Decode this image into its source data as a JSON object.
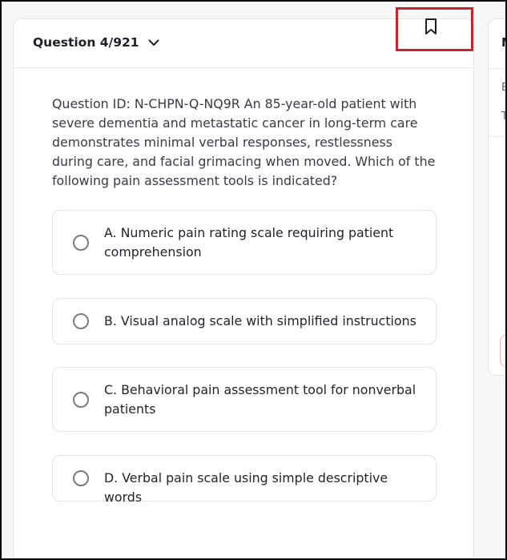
{
  "header": {
    "question_counter": "Question 4/921",
    "chevron_icon": "chevron-down-icon",
    "bookmark_icon": "bookmark-icon"
  },
  "question": {
    "text": "Question ID: N-CHPN-Q-NQ9R An 85-year-old patient with severe dementia and metastatic cancer in long-term care demonstrates minimal verbal responses, restlessness during care, and facial grimacing when moved. Which of the following pain assessment tools is indicated?"
  },
  "options": [
    {
      "label": "A. Numeric pain rating scale requiring patient comprehension"
    },
    {
      "label": "B. Visual analog scale with simplified instructions"
    },
    {
      "label": "C. Behavioral pain assessment tool for nonverbal patients"
    },
    {
      "label": "D. Verbal pain scale using simple descriptive words"
    }
  ],
  "right_panel": {
    "top_letter": "N",
    "line1": "E",
    "line2": "T"
  },
  "colors": {
    "highlight_box": "#c8242b",
    "card_bg": "#ffffff",
    "page_bg": "#f7f7f8"
  }
}
